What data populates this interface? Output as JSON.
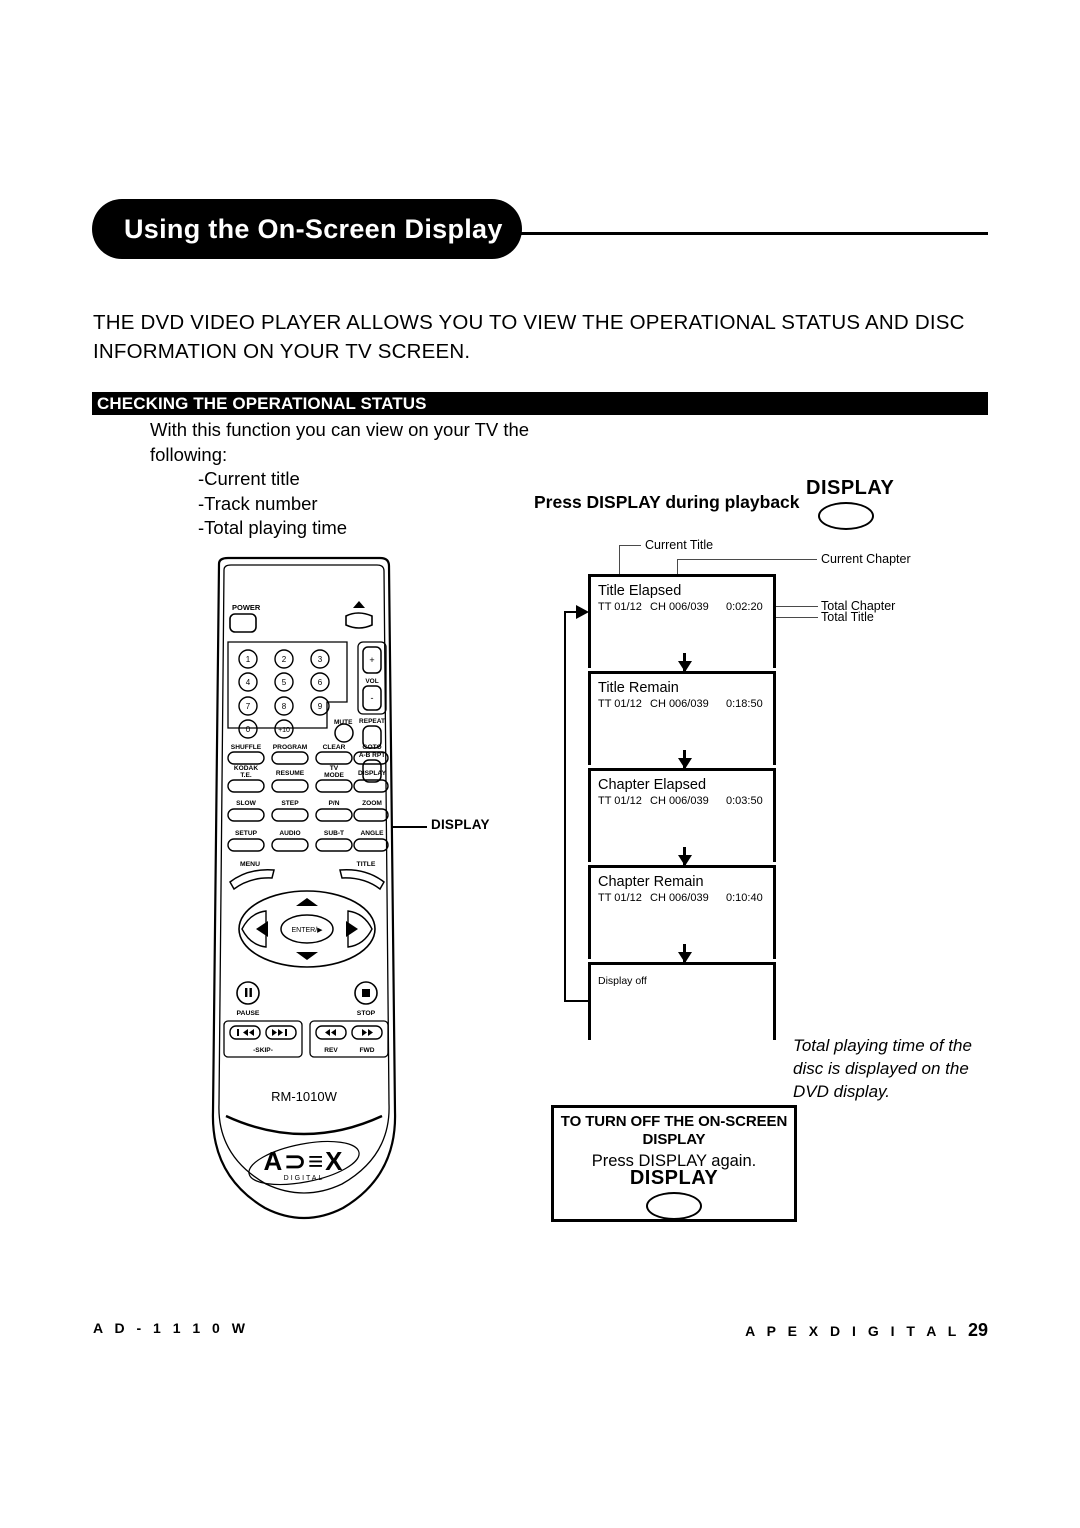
{
  "header": {
    "title": "Using the On-Screen Display"
  },
  "intro": {
    "line1": "THE DVD VIDEO PLAYER ALLOWS YOU TO VIEW THE OPERATIONAL STATUS AND DISC",
    "line2": "INFORMATION ON YOUR TV SCREEN."
  },
  "section": {
    "heading": "CHECKING THE OPERATIONAL STATUS",
    "body_line1": "With this function you can view on your TV the",
    "body_line2": "following:",
    "bullets": [
      "-Current title",
      "-Track number",
      "-Total playing time"
    ]
  },
  "press": {
    "instruction": "Press DISPLAY during playback",
    "button_label": "DISPLAY"
  },
  "callout": {
    "display_label": "DISPLAY"
  },
  "flow": {
    "labels": {
      "current_title": "Current Title",
      "current_chapter": "Current Chapter",
      "total_chapter": "Total Chapter",
      "total_title": "Total Title"
    },
    "screens": [
      {
        "mode": "Title Elapsed",
        "tt": "TT  01/12",
        "ch": "CH  006/039",
        "time": "0:02:20"
      },
      {
        "mode": "Title Remain",
        "tt": "TT  01/12",
        "ch": "CH  006/039",
        "time": "0:18:50"
      },
      {
        "mode": "Chapter Elapsed",
        "tt": "TT  01/12",
        "ch": "CH  006/039",
        "time": "0:03:50"
      },
      {
        "mode": "Chapter Remain",
        "tt": "TT  01/12",
        "ch": "CH  006/039",
        "time": "0:10:40"
      },
      {
        "mode": "Display off",
        "tt": "",
        "ch": "",
        "time": ""
      }
    ]
  },
  "note": {
    "text": "Total playing time of the disc is displayed on the DVD display."
  },
  "turn_off": {
    "heading_line1": "TO TURN OFF THE ON-SCREEN",
    "heading_line2": "DISPLAY",
    "instruction": "Press DISPLAY again.",
    "button_label": "DISPLAY"
  },
  "remote": {
    "model": "RM-1010W",
    "brand": "APEX",
    "brand_sub": "DIGITAL",
    "power": "POWER",
    "eject_icon": "eject-icon",
    "vol_label": "VOL",
    "vol_plus": "+",
    "vol_minus": "-",
    "repeat": "REPEAT",
    "ab_repeat": "A-B RPT",
    "mute": "MUTE",
    "numbers": [
      "1",
      "2",
      "3",
      "4",
      "5",
      "6",
      "7",
      "8",
      "9",
      "0",
      "+10"
    ],
    "function_rows": [
      [
        "SHUFFLE",
        "PROGRAM",
        "CLEAR",
        "GOTO"
      ],
      [
        "KODAK\nT.E.",
        "RESUME",
        "TV\nMODE",
        "DISPLAY"
      ],
      [
        "SLOW",
        "STEP",
        "P/N",
        "ZOOM"
      ],
      [
        "SETUP",
        "AUDIO",
        "SUB-T",
        "ANGLE"
      ]
    ],
    "menu": "MENU",
    "title": "TITLE",
    "enter": "ENTER/▶",
    "pause": "PAUSE",
    "stop": "STOP",
    "skip": "-SKIP-",
    "rev": "REV",
    "fwd": "FWD"
  },
  "footer": {
    "left": "A D - 1 1 1 0 W",
    "right": "A P E X    D I G I T A L",
    "page": "29"
  },
  "colors": {
    "ink": "#000000",
    "leader": "#4a4a4a",
    "paper": "#ffffff"
  }
}
